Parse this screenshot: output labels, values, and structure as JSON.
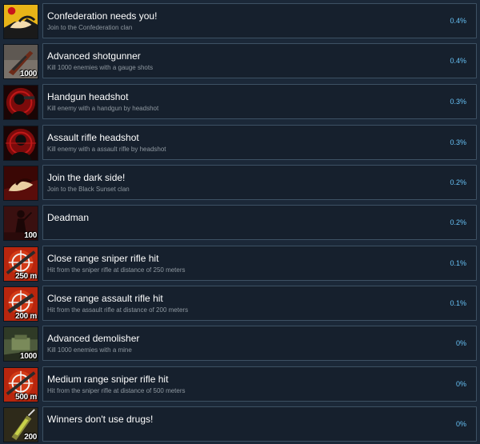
{
  "achievements": [
    {
      "title": "Confederation needs you!",
      "description": "Join to the Confederation clan",
      "percent": "0.4%",
      "icon": "handshake-yellow-icon",
      "badge": ""
    },
    {
      "title": "Advanced shotgunner",
      "description": "Kill 1000 enemies with a gauge shots",
      "percent": "0.4%",
      "icon": "shotgun-icon",
      "badge": "1000"
    },
    {
      "title": "Handgun headshot",
      "description": "Kill enemy with a handgun by headshot",
      "percent": "0.3%",
      "icon": "handgun-headshot-icon",
      "badge": ""
    },
    {
      "title": "Assault rifle headshot",
      "description": "Kill enemy with a assault rifle by headshot",
      "percent": "0.3%",
      "icon": "rifle-headshot-icon",
      "badge": ""
    },
    {
      "title": "Join the dark side!",
      "description": "Join to the Black Sunset clan",
      "percent": "0.2%",
      "icon": "handshake-dark-icon",
      "badge": ""
    },
    {
      "title": "Deadman",
      "description": "",
      "percent": "0.2%",
      "icon": "deadman-icon",
      "badge": "100"
    },
    {
      "title": "Close range sniper rifle hit",
      "description": "Hit from the sniper rifle at distance of 250 meters",
      "percent": "0.1%",
      "icon": "sniper-scope-icon",
      "badge": "250 m"
    },
    {
      "title": "Close range assault rifle hit",
      "description": "Hit from the assault rifle at distance of 200 meters",
      "percent": "0.1%",
      "icon": "assault-scope-icon",
      "badge": "200 m"
    },
    {
      "title": "Advanced demolisher",
      "description": "Kill 1000 enemies with a mine",
      "percent": "0%",
      "icon": "mine-icon",
      "badge": "1000"
    },
    {
      "title": "Medium range sniper rifle hit",
      "description": "Hit from the sniper rifle at distance of 500 meters",
      "percent": "0%",
      "icon": "sniper-scope-icon",
      "badge": "500 m"
    },
    {
      "title": "Winners don't use drugs!",
      "description": "",
      "percent": "0%",
      "icon": "syringe-icon",
      "badge": "200"
    }
  ]
}
